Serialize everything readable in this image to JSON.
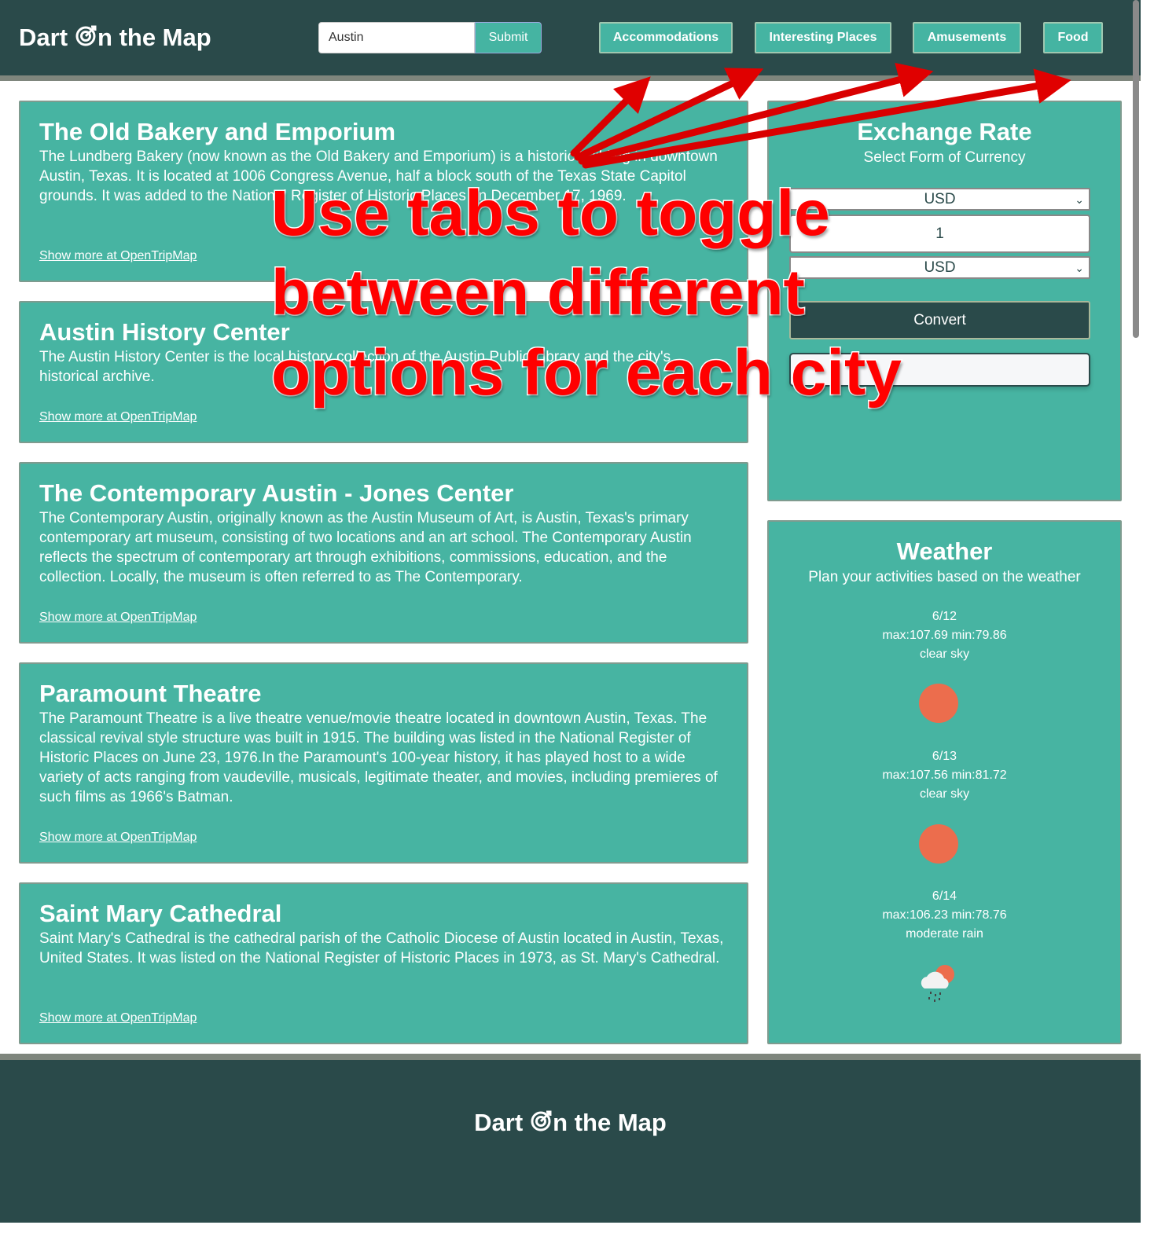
{
  "header": {
    "logo": "Dart",
    "logo_rest": "n the Map",
    "search_value": "Austin",
    "submit": "Submit",
    "tabs": [
      "Accommodations",
      "Interesting Places",
      "Amusements",
      "Food"
    ]
  },
  "places": [
    {
      "title": "The Old Bakery and Emporium",
      "desc": "The Lundberg Bakery (now known as the Old Bakery and Emporium) is a historic building in downtown Austin, Texas. It is located at 1006 Congress Avenue, half a block south of the Texas State Capitol grounds. It was added to the National Register of Historic Places on December 17, 1969.",
      "link": "Show more at OpenTripMap"
    },
    {
      "title": "Austin History Center",
      "desc": "The Austin History Center is the local history collection of the Austin Public Library and the city's historical archive.",
      "link": "Show more at OpenTripMap"
    },
    {
      "title": "The Contemporary Austin - Jones Center",
      "desc": "The Contemporary Austin, originally known as the Austin Museum of Art, is Austin, Texas's primary contemporary art museum, consisting of two locations and an art school. The Contemporary Austin reflects the spectrum of contemporary art through exhibitions, commissions, education, and the collection. Locally, the museum is often referred to as The Contemporary.",
      "link": "Show more at OpenTripMap"
    },
    {
      "title": "Paramount Theatre",
      "desc": "The Paramount Theatre is a live theatre venue/movie theatre located in downtown Austin, Texas. The classical revival style structure was built in 1915. The building was listed in the National Register of Historic Places on June 23, 1976.In the Paramount's 100-year history, it has played host to a wide variety of acts ranging from vaudeville, musicals, legitimate theater, and movies, including premieres of such films as 1966's Batman.",
      "link": "Show more at OpenTripMap"
    },
    {
      "title": "Saint Mary Cathedral",
      "desc": "Saint Mary's Cathedral is the cathedral parish of the Catholic Diocese of Austin located in Austin, Texas, United States. It was listed on the National Register of Historic Places in 1973, as St. Mary's Cathedral.",
      "link": "Show more at OpenTripMap"
    }
  ],
  "exchange": {
    "title": "Exchange Rate",
    "subtitle": "Select Form of Currency",
    "from": "USD",
    "amount": "1",
    "to": "USD",
    "convert": "Convert",
    "result": ""
  },
  "weather": {
    "title": "Weather",
    "subtitle": "Plan your activities based on the weather",
    "days": [
      {
        "date": "6/12",
        "temps": "max:107.69 min:79.86",
        "desc": "clear sky",
        "icon": "sun-icon"
      },
      {
        "date": "6/13",
        "temps": "max:107.56 min:81.72",
        "desc": "clear sky",
        "icon": "sun-icon"
      },
      {
        "date": "6/14",
        "temps": "max:106.23 min:78.76",
        "desc": "moderate rain",
        "icon": "rain-cloud-sun-icon"
      }
    ]
  },
  "footer": {
    "logo": "Dart",
    "logo_rest": "n the Map"
  },
  "annotation": {
    "line1": "Use tabs to toggle",
    "line2": "between different",
    "line3": "options for each city"
  },
  "colors": {
    "header": "#2a4a4a",
    "card": "#47b4a2",
    "sun": "#ec6d4d",
    "annotation": "#ff0000"
  }
}
